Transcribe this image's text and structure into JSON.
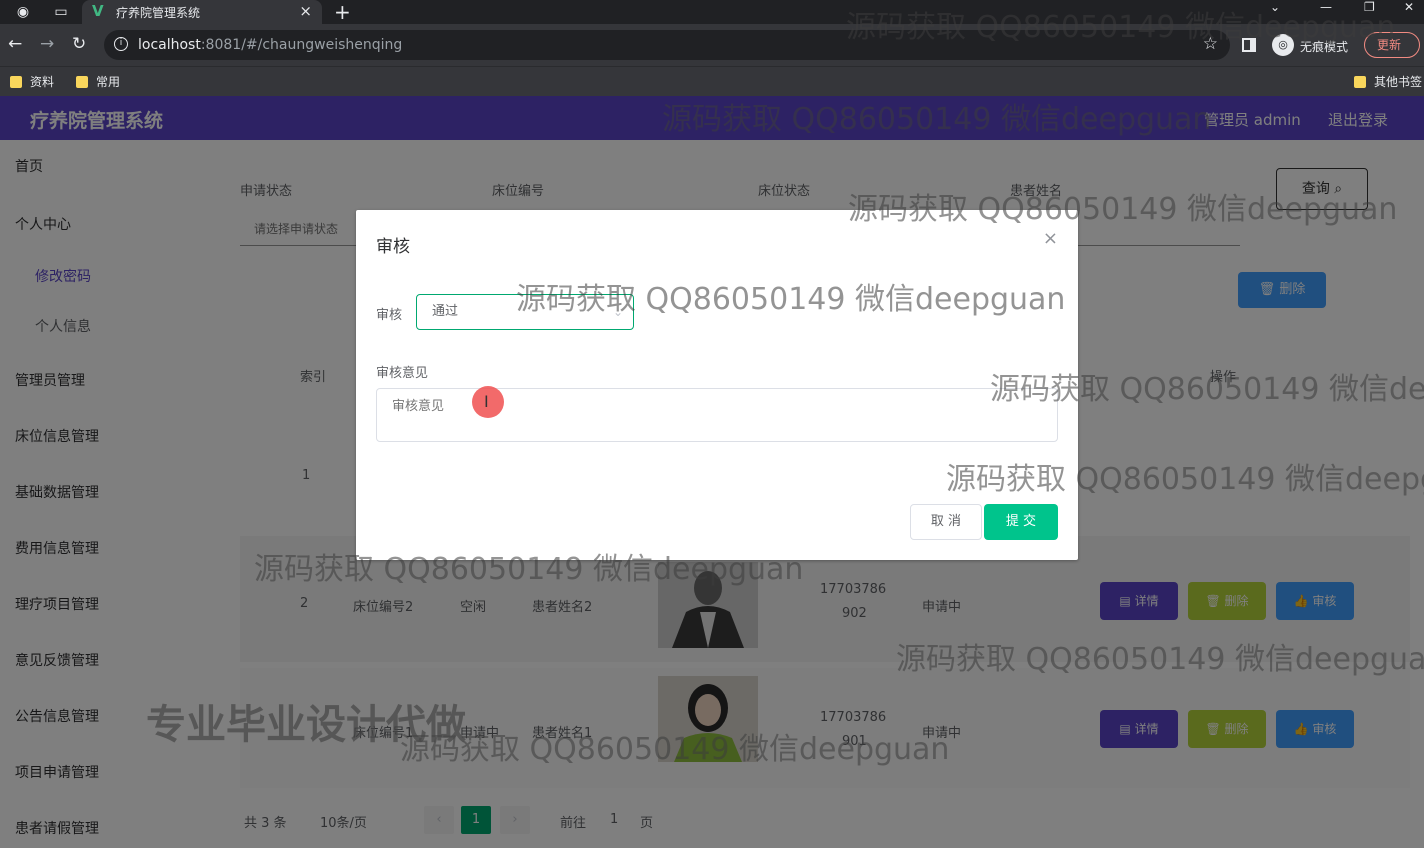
{
  "browser": {
    "tab_title": "疗养院管理系统",
    "url_host": "localhost",
    "url_path": ":8081/#/chaungweishenqing",
    "incognito_label": "无痕模式",
    "update_label": "更新",
    "bookmarks": [
      "资料",
      "常用",
      "其他书签"
    ]
  },
  "header": {
    "app_title": "疗养院管理系统",
    "admin_label": "管理员 admin",
    "logout_label": "退出登录"
  },
  "sidebar": {
    "items": [
      {
        "label": "首页"
      },
      {
        "label": "个人中心"
      },
      {
        "label": "修改密码"
      },
      {
        "label": "个人信息"
      },
      {
        "label": "管理员管理"
      },
      {
        "label": "床位信息管理"
      },
      {
        "label": "基础数据管理"
      },
      {
        "label": "费用信息管理"
      },
      {
        "label": "理疗项目管理"
      },
      {
        "label": "意见反馈管理"
      },
      {
        "label": "公告信息管理"
      },
      {
        "label": "项目申请管理"
      },
      {
        "label": "患者请假管理"
      }
    ]
  },
  "search": {
    "labels": [
      "申请状态",
      "床位编号",
      "床位状态",
      "患者姓名"
    ],
    "placeholder": "请选择申请状态",
    "query_label": "查询",
    "batch_delete_label": "删除"
  },
  "table": {
    "headers": [
      "索引",
      "操作"
    ],
    "rows": [
      {
        "index": "1"
      },
      {
        "index": "2",
        "bed_no": "床位编号2",
        "bed_status": "空闲",
        "patient": "患者姓名2",
        "phone_a": "17703786",
        "phone_b": "902",
        "status": "申请中"
      },
      {
        "index": "3",
        "bed_no": "床位编号1",
        "bed_status": "申请中",
        "patient": "患者姓名1",
        "phone_a": "17703786",
        "phone_b": "901",
        "status": "申请中"
      }
    ],
    "actions": {
      "detail": "详情",
      "delete": "删除",
      "audit": "审核"
    }
  },
  "pagination": {
    "total": "共 3 条",
    "page_size": "10条/页",
    "current": "1",
    "goto_prefix": "前往",
    "goto_value": "1",
    "goto_suffix": "页"
  },
  "dialog": {
    "title": "审核",
    "audit_label": "审核",
    "audit_value": "通过",
    "opinion_label": "审核意见",
    "opinion_placeholder": "审核意见",
    "cancel_label": "取 消",
    "submit_label": "提 交"
  },
  "watermark": {
    "text": "源码获取 QQ86050149 微信deepguan",
    "promo": "专业毕业设计代做"
  }
}
